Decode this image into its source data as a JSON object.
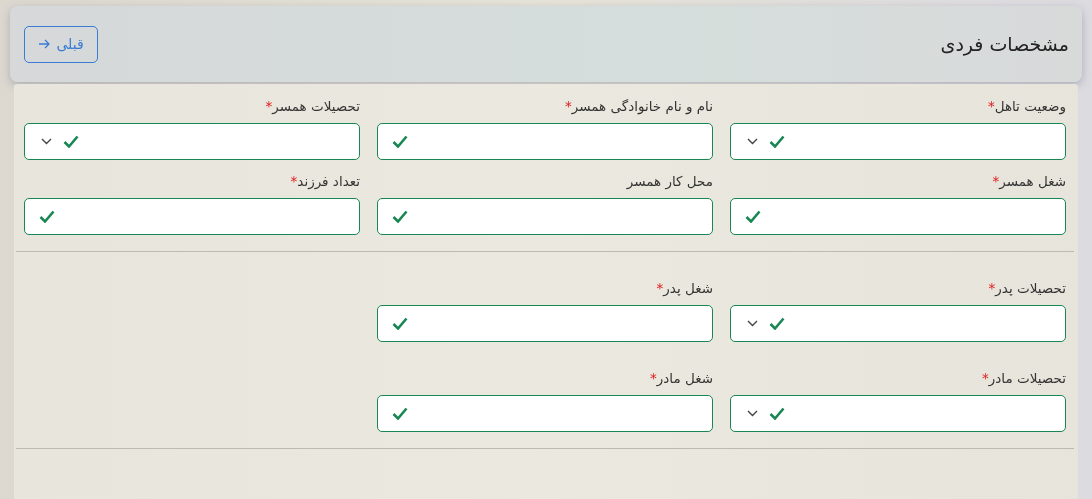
{
  "header": {
    "title": "مشخصات فردی",
    "back_button": "قبلی"
  },
  "sections": [
    {
      "fields": [
        {
          "label": "وضعیت تاهل",
          "required_mark": "*",
          "kind": "select",
          "valid": true
        },
        {
          "label": "نام و نام خانوادگی همسر",
          "required_mark": "*",
          "kind": "text",
          "valid": true
        },
        {
          "label": "تحصیلات همسر",
          "required_mark": "*",
          "kind": "select",
          "valid": true
        },
        {
          "label": "شغل همسر",
          "required_mark": "*",
          "kind": "text",
          "valid": true
        },
        {
          "label": "محل کار همسر",
          "kind": "text",
          "valid": true
        },
        {
          "label": "تعداد فرزند",
          "required_mark": "*",
          "kind": "text",
          "valid": true
        }
      ]
    },
    {
      "fields": [
        {
          "label": "تحصیلات پدر",
          "required_mark": "*",
          "kind": "select",
          "valid": true
        },
        {
          "label": "شغل پدر",
          "required_mark": "*",
          "kind": "text",
          "valid": true
        }
      ]
    },
    {
      "fields": [
        {
          "label": "تحصیلات مادر",
          "required_mark": "*",
          "kind": "select",
          "valid": true
        },
        {
          "label": "شغل مادر",
          "required_mark": "*",
          "kind": "text",
          "valid": true
        }
      ]
    }
  ]
}
